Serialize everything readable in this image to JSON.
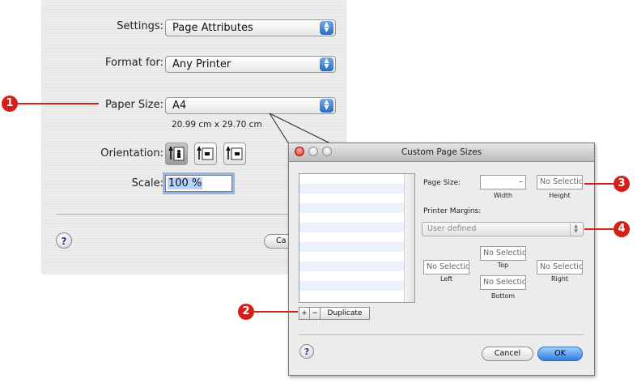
{
  "page_setup": {
    "settings": {
      "label": "Settings:",
      "value": "Page Attributes"
    },
    "format_for": {
      "label": "Format for:",
      "value": "Any Printer"
    },
    "paper_size": {
      "label": "Paper Size:",
      "value": "A4",
      "dimensions": "20.99 cm x 29.70 cm"
    },
    "orientation": {
      "label": "Orientation:",
      "selected": "portrait"
    },
    "scale": {
      "label": "Scale:",
      "value": "100 %"
    },
    "help_glyph": "?",
    "cancel_partial": "Ca"
  },
  "custom_window": {
    "title": "Custom Page Sizes",
    "page_size": {
      "label": "Page Size:",
      "width_value": "–",
      "height_value": "No Selectic",
      "width_label": "Width",
      "height_label": "Height"
    },
    "printer_margins": {
      "label": "Printer Margins:",
      "value": "User defined"
    },
    "margins": {
      "top": {
        "value": "No Selectic",
        "label": "Top"
      },
      "left": {
        "value": "No Selectic",
        "label": "Left"
      },
      "right": {
        "value": "No Selectic",
        "label": "Right"
      },
      "bottom": {
        "value": "No Selectic",
        "label": "Bottom"
      }
    },
    "list_buttons": {
      "add": "+",
      "remove": "−",
      "duplicate": "Duplicate"
    },
    "help_glyph": "?",
    "cancel_label": "Cancel",
    "ok_label": "OK"
  },
  "callouts": [
    "1",
    "2",
    "3",
    "4"
  ],
  "colors": {
    "callout": "#d2201a",
    "selection": "#b6d4ff",
    "default_button": "#2d7be0"
  }
}
